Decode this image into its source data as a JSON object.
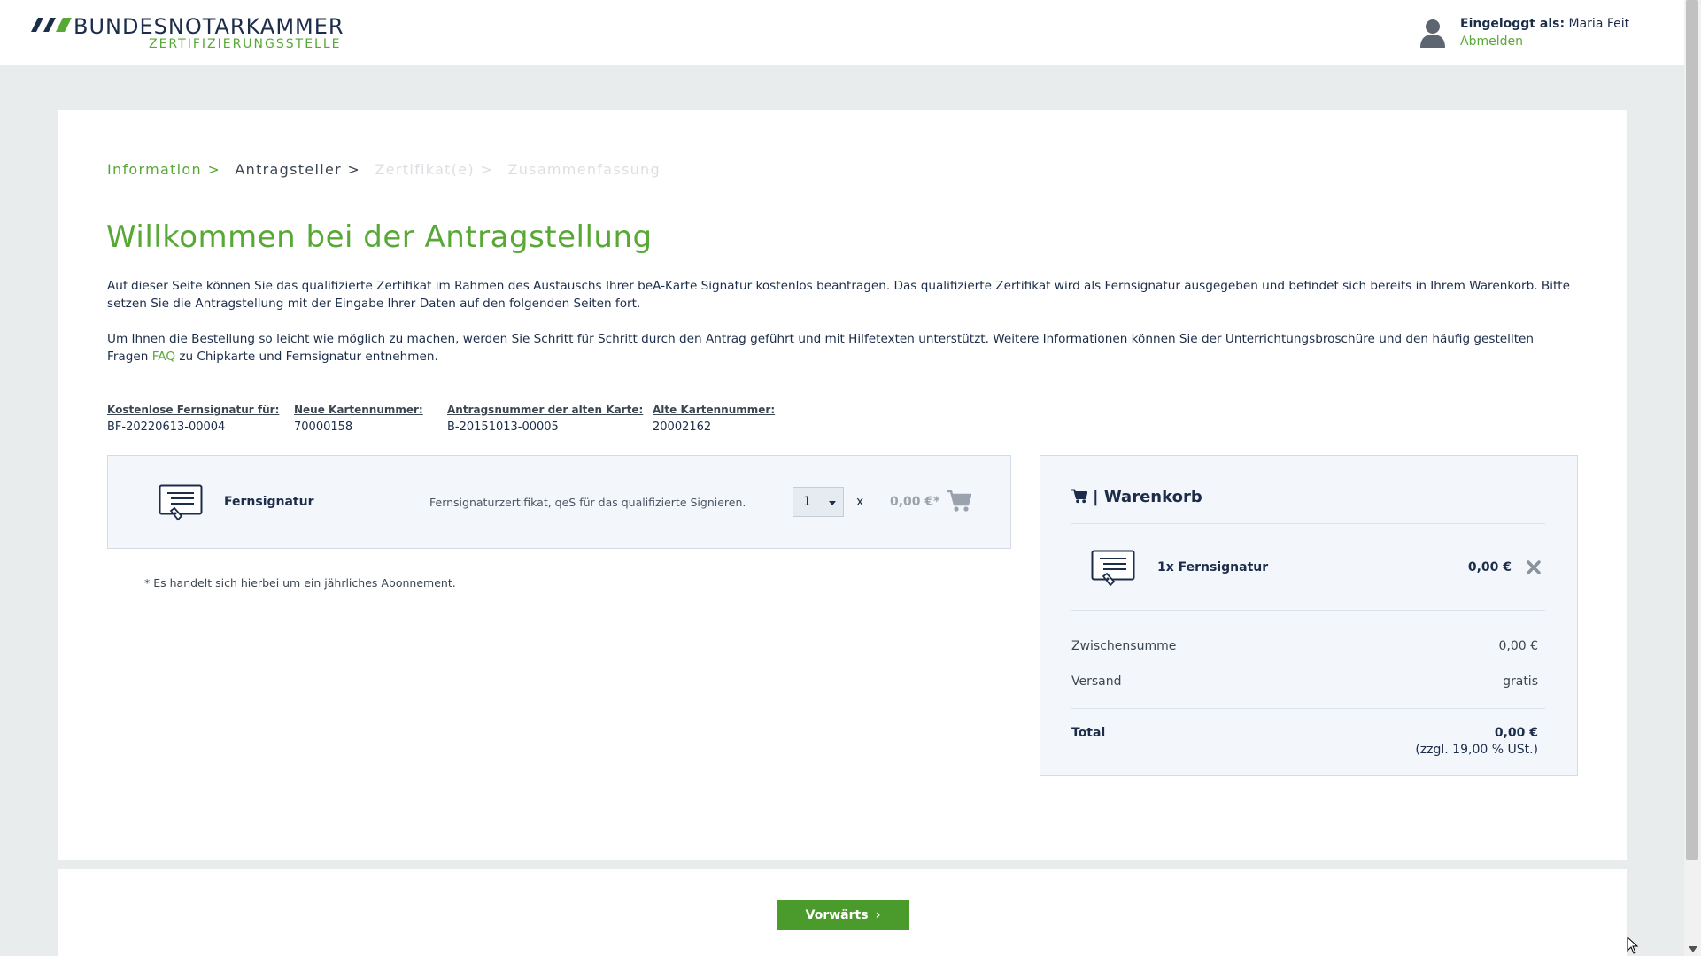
{
  "header": {
    "logo_title": "BUNDESNOTARKAMMER",
    "logo_subtitle": "ZERTIFIZIERUNGSSTELLE",
    "logged_in_label": "Eingeloggt als:",
    "user_name": "Maria Feit",
    "logout_label": "Abmelden"
  },
  "breadcrumb": {
    "steps": [
      {
        "label": "Information",
        "state": "active"
      },
      {
        "label": "Antragsteller",
        "state": "done"
      },
      {
        "label": "Zertifikat(e)",
        "state": "future"
      },
      {
        "label": "Zusammenfassung",
        "state": "future"
      }
    ],
    "separator": ">"
  },
  "main": {
    "title": "Willkommen bei der Antragstellung",
    "intro_p1": "Auf dieser Seite können Sie das qualifizierte Zertifikat im Rahmen des Austauschs Ihrer beA-Karte Signatur kostenlos beantragen. Das qualifizierte Zertifikat wird als Fernsignatur ausgegeben und befindet sich bereits in Ihrem Warenkorb. Bitte setzen Sie die Antragstellung mit der Eingabe Ihrer Daten auf den folgenden Seiten fort.",
    "intro_p2_before": "Um Ihnen die Bestellung so leicht wie möglich zu machen, werden Sie Schritt für Schritt durch den Antrag geführt und mit Hilfetexten unterstützt. Weitere Informationen können Sie der Unterrichtungsbroschüre und den häufig gestellten Fragen ",
    "intro_p2_link": "FAQ",
    "intro_p2_after": " zu Chipkarte und Fernsignatur entnehmen."
  },
  "info": [
    {
      "label": "Kostenlose Fernsignatur für:",
      "value": "BF-20220613-00004"
    },
    {
      "label": "Neue Kartennummer:",
      "value": "70000158"
    },
    {
      "label": "Antragsnummer der alten Karte:",
      "value": "B-20151013-00005"
    },
    {
      "label": "Alte Kartennummer:",
      "value": "20002162"
    }
  ],
  "product": {
    "name": "Fernsignatur",
    "description": "Fernsignaturzertifikat, qeS für das qualifizierte Signieren.",
    "quantity": "1",
    "times": "x",
    "price": "0,00 €*",
    "icon": "certificate-icon"
  },
  "footnote": "*  Es handelt sich hierbei um ein jährliches Abonnement.",
  "basket": {
    "title": "| Warenkorb",
    "item_name": "1x Fernsignatur",
    "item_price": "0,00 €",
    "subtotal_label": "Zwischensumme",
    "subtotal_value": "0,00 €",
    "shipping_label": "Versand",
    "shipping_value": "gratis",
    "total_label": "Total",
    "total_value": "0,00 €",
    "tax_note": "(zzgl. 19,00 % USt.)"
  },
  "footer": {
    "forward_label": "Vorwärts"
  },
  "colors": {
    "brand_green": "#58a836",
    "button_green": "#4b9b2c",
    "navy": "#1c2d4a"
  }
}
